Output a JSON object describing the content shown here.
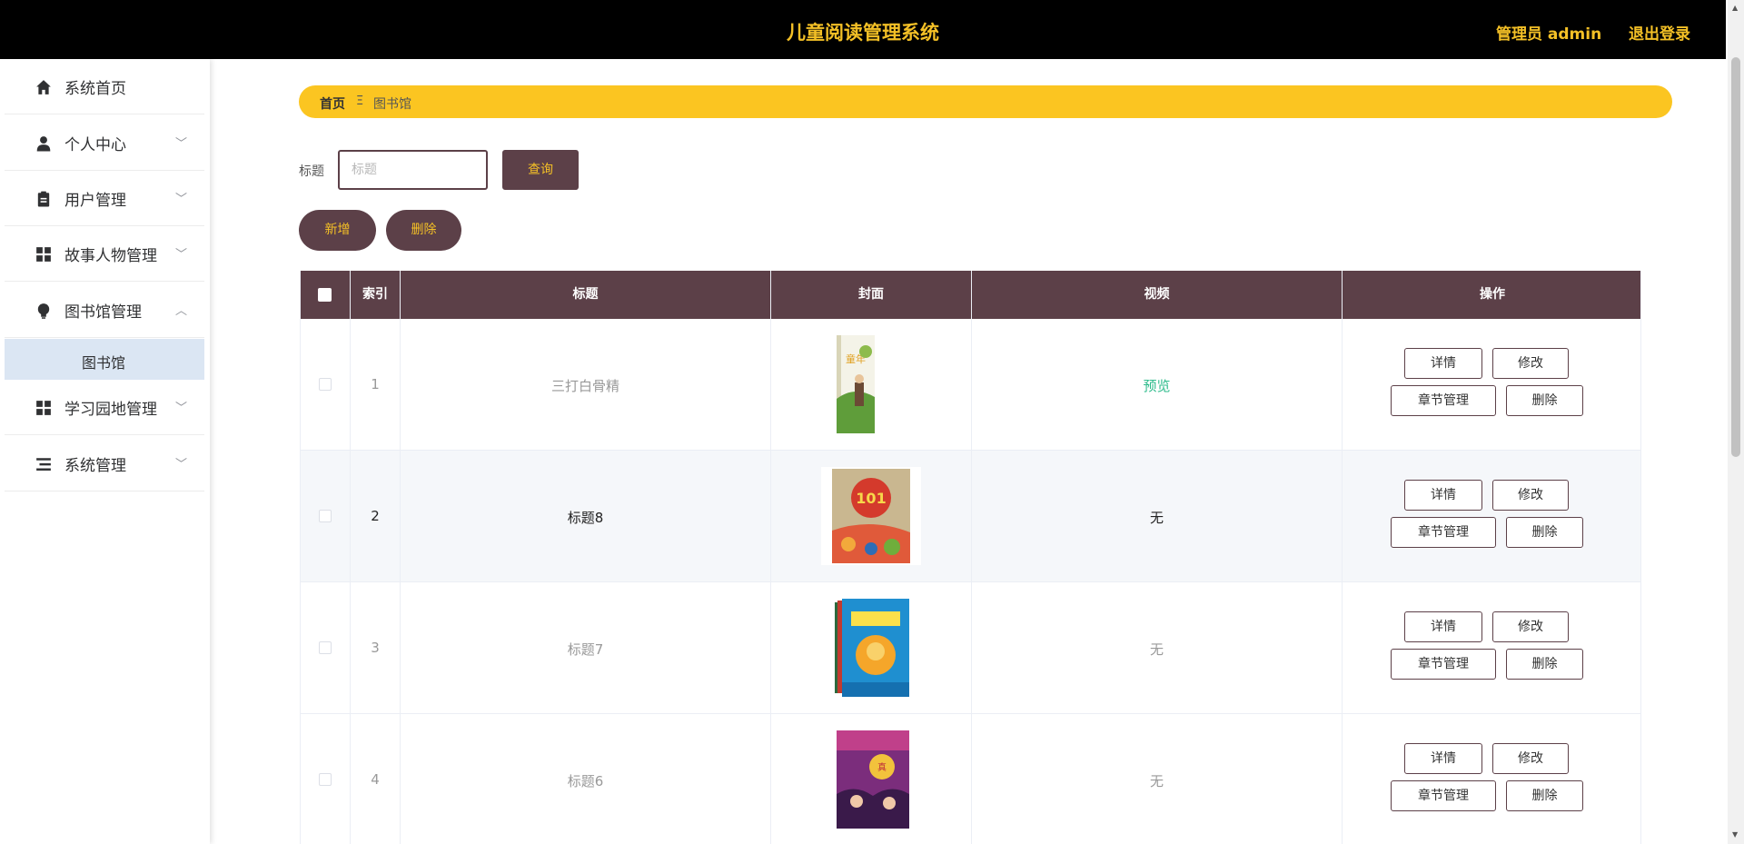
{
  "header": {
    "title": "儿童阅读管理系统",
    "admin": "管理员 admin",
    "logout": "退出登录"
  },
  "colors": {
    "accent": "#f4c026",
    "primary": "#5c4048",
    "breadcrumb_bg": "#fbc521",
    "preview_link": "#2dbb8b"
  },
  "sidebar": {
    "items": [
      {
        "label": "系统首页",
        "icon": "home-icon"
      },
      {
        "label": "个人中心",
        "icon": "user-icon"
      },
      {
        "label": "用户管理",
        "icon": "clipboard-icon"
      },
      {
        "label": "故事人物管理",
        "icon": "grid-icon"
      },
      {
        "label": "图书馆管理",
        "icon": "bulb-icon"
      },
      {
        "label": "学习园地管理",
        "icon": "grid-icon"
      },
      {
        "label": "系统管理",
        "icon": "list-icon"
      }
    ],
    "sub_active": "图书馆"
  },
  "breadcrumb": {
    "home": "首页",
    "separator": "Ξ",
    "current": "图书馆"
  },
  "search": {
    "label": "标题",
    "placeholder": "标题",
    "value": "",
    "button": "查询"
  },
  "actions": {
    "add": "新增",
    "delete": "删除"
  },
  "table": {
    "headers": [
      "索引",
      "标题",
      "封面",
      "视频",
      "操作"
    ],
    "rows": [
      {
        "index": "1",
        "title": "三打白骨精",
        "cover": "cover-book-tongnian",
        "video": "预览"
      },
      {
        "index": "2",
        "title": "标题8",
        "cover": "cover-book-101-fairy-tales",
        "video": "无"
      },
      {
        "index": "3",
        "title": "标题7",
        "cover": "cover-book-blue-adventure",
        "video": "无"
      },
      {
        "index": "4",
        "title": "标题6",
        "cover": "cover-book-purple-princess",
        "video": "无"
      }
    ],
    "row_buttons": {
      "detail": "详情",
      "edit": "修改",
      "chapter": "章节管理",
      "delete": "删除"
    }
  }
}
